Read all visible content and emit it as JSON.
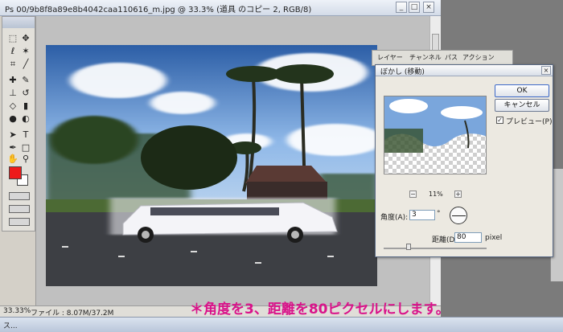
{
  "document": {
    "title": "Ps 00/9b8f8a89e8b4042caa110616_m.jpg @ 33.3% (道具 のコピー 2, RGB/8)",
    "zoom": "33.3%",
    "status_zoom": "33.33%",
    "status_file": "ファイル : 8.07M/37.2M"
  },
  "window_buttons": {
    "minimize": "_",
    "maximize": "□",
    "close": "×"
  },
  "layers_panel": {
    "tabs": [
      "レイヤー",
      "チャンネル",
      "パス",
      "アクション"
    ]
  },
  "dialog": {
    "title": "ぼかし (移動)",
    "ok_label": "OK",
    "cancel_label": "キャンセル",
    "preview_label": "プレビュー(P)",
    "preview_checked": true,
    "zoom_value": "11%",
    "zoom_minus": "−",
    "zoom_plus": "+",
    "angle_label": "角度(A):",
    "angle_value": "3",
    "angle_unit": "°",
    "distance_label": "距離(D):",
    "distance_value": "80",
    "distance_unit": "pixel"
  },
  "taskbar": {
    "label": "ス..."
  },
  "caption": "＊角度を3、距離を80ピクセルにします。",
  "colors": {
    "foreground": "#ee1a1a",
    "background": "#ffffff",
    "caption": "#d9138a"
  }
}
